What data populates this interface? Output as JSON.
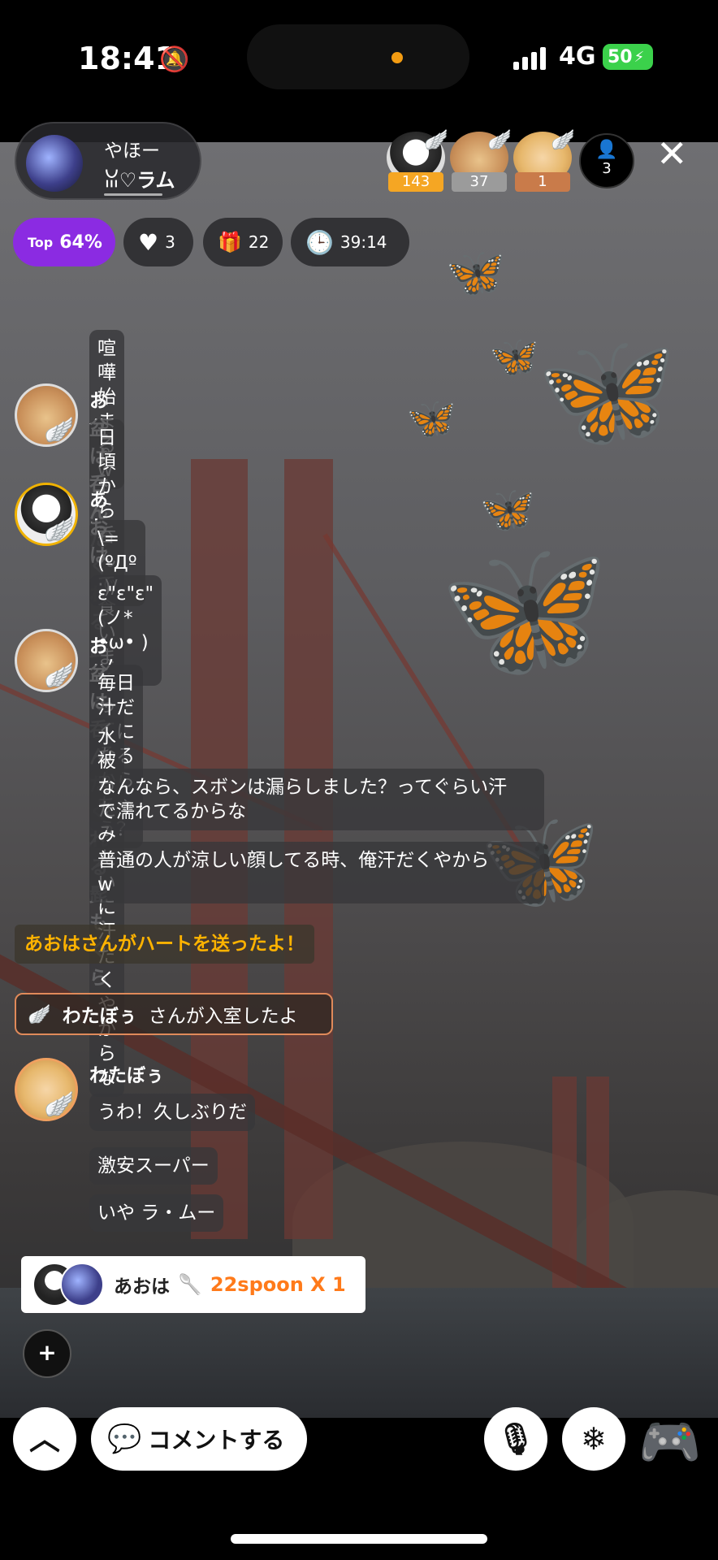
{
  "status_bar": {
    "time": "18:41",
    "network": "4G",
    "battery": "50"
  },
  "host": {
    "line1": "やほー",
    "line2": "ꈍ♡ラム"
  },
  "rankers": [
    {
      "count": "143",
      "color": "#f5a623"
    },
    {
      "count": "37",
      "color": "#9b9b9b"
    },
    {
      "count": "1",
      "color": "#c97b4a"
    }
  ],
  "viewers": "3",
  "stats": {
    "top_label": "Top",
    "top_value": "64%",
    "likes": "3",
    "gifts": "22",
    "timer": "39:14"
  },
  "messages": {
    "m0": "喧嘩始まるw",
    "u1": "お盆は呑んだくれる髭もぐら",
    "m1": "日頃から呑んで食いまくってるよw",
    "u2": "あおは",
    "m2": "\\=(ºДº ;)/",
    "m3": "ε\"ε\"ε\"(ノ* •ω• )ノ",
    "u3": "お盆は呑んだくれる髭もぐら",
    "m4": "毎日汁だくになるからちゃう？",
    "m5": "水被ったみたいに汗だくやからな",
    "m6a": "なんなら、スボンは漏らしました？ってぐらい汗",
    "m6b": "で濡れてるからな",
    "m7a": "普通の人が涼しい顔してる時、俺汗だくやから",
    "m7b": "w",
    "heart": "あおはさんがハートを送ったよ！",
    "enter_name": "わたぼぅ",
    "enter_text": "さんが入室したよ",
    "u4": "わたぼぅ",
    "m8": "うわ！久しぶりだ",
    "m9": "激安スーパー",
    "m10": "いや ラ・ムー"
  },
  "gift": {
    "sender": "あおは",
    "amount": "22spoon X 1"
  },
  "bottom": {
    "comment_label": "コメントする",
    "plus": "+"
  },
  "icons": [
    "bell-off-icon",
    "person-icon",
    "close-icon",
    "heart-icon",
    "gift-icon",
    "clock-icon",
    "chevron-up-icon",
    "chat-bubble-icon",
    "microphone-icon",
    "snowflake-icon",
    "game-controller-icon"
  ]
}
